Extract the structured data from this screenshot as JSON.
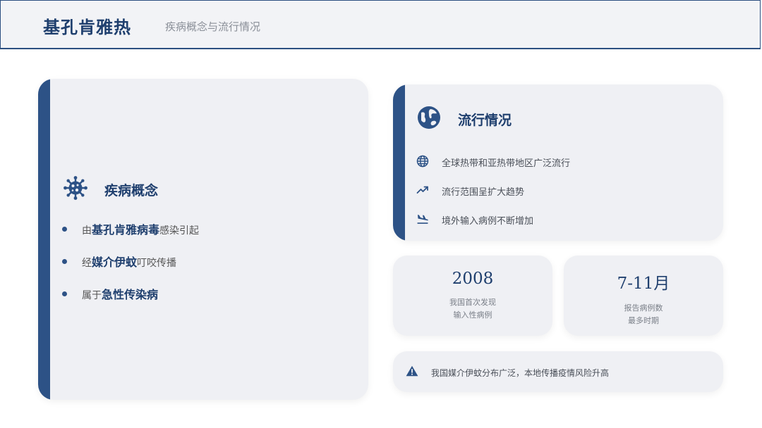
{
  "header": {
    "title": "基孔肯雅热",
    "subtitle": "疾病概念与流行情况"
  },
  "concept": {
    "title": "疾病概念",
    "icon": "virus-icon",
    "items": [
      {
        "prefix": "由",
        "bold": "基孔肯雅病毒",
        "suffix": "感染引起"
      },
      {
        "prefix": "经",
        "bold": "媒介伊蚊",
        "suffix": "叮咬传播"
      },
      {
        "prefix": "属于",
        "bold": "急性传染病",
        "suffix": ""
      }
    ]
  },
  "prevalence": {
    "title": "流行情况",
    "icon": "globe-icon",
    "items": [
      {
        "icon": "globe-small-icon",
        "text": "全球热带和亚热带地区广泛流行"
      },
      {
        "icon": "trend-up-icon",
        "text": "流行范围呈扩大趋势"
      },
      {
        "icon": "plane-landing-icon",
        "text": "境外输入病例不断增加"
      }
    ]
  },
  "stats": [
    {
      "value": "2008",
      "line1": "我国首次发现",
      "line2": "输入性病例"
    },
    {
      "value": "7-11月",
      "line1": "报告病例数",
      "line2": "最多时期"
    }
  ],
  "warning": {
    "icon": "warning-icon",
    "text": "我国媒介伊蚊分布广泛，本地传播疫情风险升高"
  },
  "colors": {
    "accent": "#2d5286",
    "card": "#eff0f4"
  }
}
